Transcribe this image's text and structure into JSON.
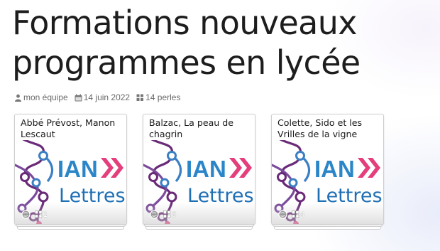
{
  "page": {
    "title": "Formations nouveaux programmes en lycée"
  },
  "meta": {
    "author": "mon équipe",
    "date": "14 juin 2022",
    "count": "14 perles",
    "icons": [
      "user-icon",
      "calendar-icon",
      "grid-icon"
    ]
  },
  "logo": {
    "text_top": "IAN",
    "text_bottom": "Lettres",
    "blue": "#2a86c8",
    "pink": "#e43e7c",
    "purple": "#6a2a78"
  },
  "cards": [
    {
      "title": "Abbé Prévost, Manon Lescaut",
      "count": "1"
    },
    {
      "title": "Balzac, La peau de chagrin",
      "count": "6"
    },
    {
      "title": "Colette, Sido et les Vrilles de la vigne",
      "count": "4"
    }
  ]
}
